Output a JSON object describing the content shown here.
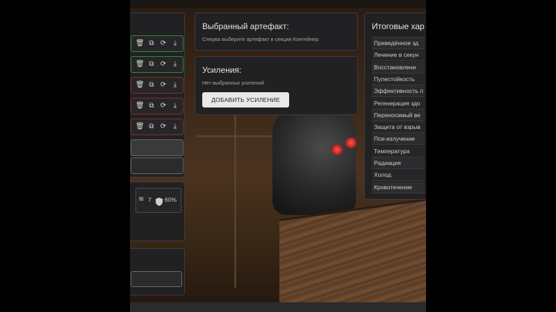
{
  "artifact_panel": {
    "title": "Выбранный артефакт:",
    "subtitle": "Сперва выберите артефакт в секции Контейнер"
  },
  "boosts_panel": {
    "title": "Усиления:",
    "subtitle": "Нет выбранных усилений",
    "add_button": "ДОБАВИТЬ УСИЛЕНИЕ"
  },
  "results_panel": {
    "title": "Итоговые хар",
    "stats": [
      "Приведённое зд",
      "Лечение в секун",
      "Восстановлени",
      "Пулестойкость",
      "Эффективность л",
      "Регенерация здо",
      "Переносимый ве",
      "Защита от взрыв",
      "Пси-излучение",
      "Температура",
      "Радиация",
      "Холод",
      "Кровотечение"
    ]
  },
  "container_info": {
    "slots_count": "7",
    "protection": "60%"
  },
  "slot_icons": [
    "trash-icon",
    "copy-icon",
    "refresh-icon",
    "download-icon"
  ],
  "slot_states": [
    "green",
    "green",
    "red",
    "red",
    "red"
  ],
  "colors": {
    "green_border": "#2f8a3a",
    "red_border": "#8a2d2d",
    "panel_bg": "#212123"
  }
}
